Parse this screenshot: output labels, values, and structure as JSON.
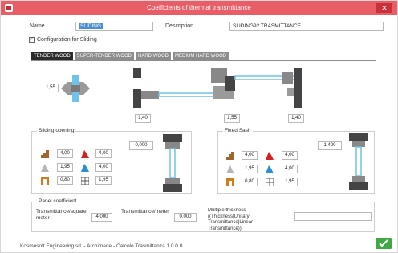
{
  "window": {
    "title": "Coefficients of thermal transmittance"
  },
  "header": {
    "name_label": "Name",
    "name_value": "SLIDING",
    "description_label": "Description",
    "description_value": "SLIDING92 TRASMITTANCE",
    "checkbox_label": "Configuration for Sliding",
    "checkbox_checked": true
  },
  "tabs": [
    "TENDER WOOD",
    "SUPER-TENDER WOOD",
    "HARD WOOD",
    "MEDIUM HARD WOOD"
  ],
  "profiles": {
    "left_value": "1,55",
    "values": [
      "1,40",
      "1,55",
      "1,40"
    ]
  },
  "sliding_opening": {
    "title": "Sliding opening",
    "glass_value": "0,000",
    "rows": [
      [
        "4,00",
        "4,00"
      ],
      [
        "1,95",
        "4,00"
      ],
      [
        "0,80",
        "1,95"
      ]
    ]
  },
  "fixed_sash": {
    "title": "Fixed Sash",
    "glass_value": "1,400",
    "rows": [
      [
        "4,00",
        "4,00"
      ],
      [
        "1,95",
        "4,00"
      ],
      [
        "0,80",
        "1,95"
      ]
    ]
  },
  "panel": {
    "title": "Panel coefficient",
    "trans_sq_label": "Transmittance/square meter",
    "trans_sq_value": "4,000",
    "trans_m_label": "Transmittance/meter",
    "trans_m_value": "0,000",
    "multi_label": "Multiple thickness ((Thickness|Unitary Transmittance|Linear Transmittance))",
    "multi_value": ""
  },
  "status": "Kosmosoft Engineering srl. - Archimede - Calcolo Trasmittanza 1.0.0.0",
  "colors": {
    "titlebar": "#e85d66",
    "ok": "#3faa42",
    "tab_active": "#2b2b2b",
    "glass": "#6ec3ea"
  }
}
